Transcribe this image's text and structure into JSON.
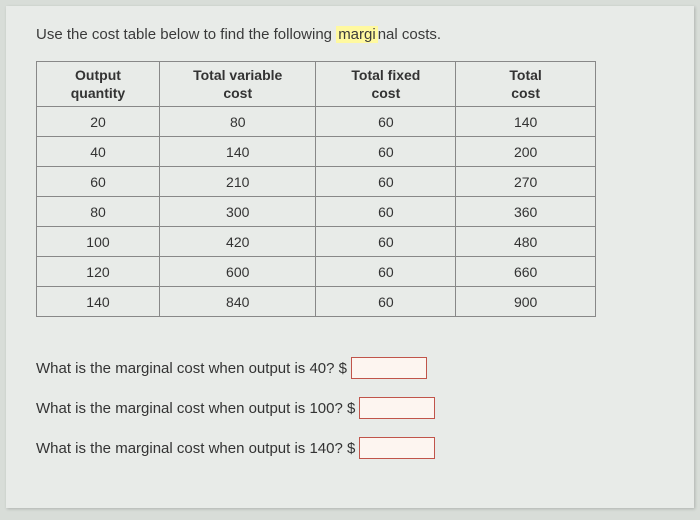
{
  "prompt": {
    "prefix": "Use the cost table below to find the following ",
    "highlight": "margi",
    "suffix": "nal costs."
  },
  "table": {
    "headers": {
      "output_line1": "Output",
      "output_line2": "quantity",
      "tvc_line1": "Total variable",
      "tvc_line2": "cost",
      "tfc_line1": "Total fixed",
      "tfc_line2": "cost",
      "tc_line1": "Total",
      "tc_line2": "cost"
    },
    "rows": [
      {
        "output": "20",
        "tvc": "80",
        "tfc": "60",
        "tc": "140"
      },
      {
        "output": "40",
        "tvc": "140",
        "tfc": "60",
        "tc": "200"
      },
      {
        "output": "60",
        "tvc": "210",
        "tfc": "60",
        "tc": "270"
      },
      {
        "output": "80",
        "tvc": "300",
        "tfc": "60",
        "tc": "360"
      },
      {
        "output": "100",
        "tvc": "420",
        "tfc": "60",
        "tc": "480"
      },
      {
        "output": "120",
        "tvc": "600",
        "tfc": "60",
        "tc": "660"
      },
      {
        "output": "140",
        "tvc": "840",
        "tfc": "60",
        "tc": "900"
      }
    ]
  },
  "questions": {
    "q1_text": "What is the marginal cost when output is 40?   $",
    "q2_text": "What is the marginal cost when output is 100?  $",
    "q3_text": "What is the marginal cost when output is 140?   $",
    "q1_value": "",
    "q2_value": "",
    "q3_value": ""
  }
}
